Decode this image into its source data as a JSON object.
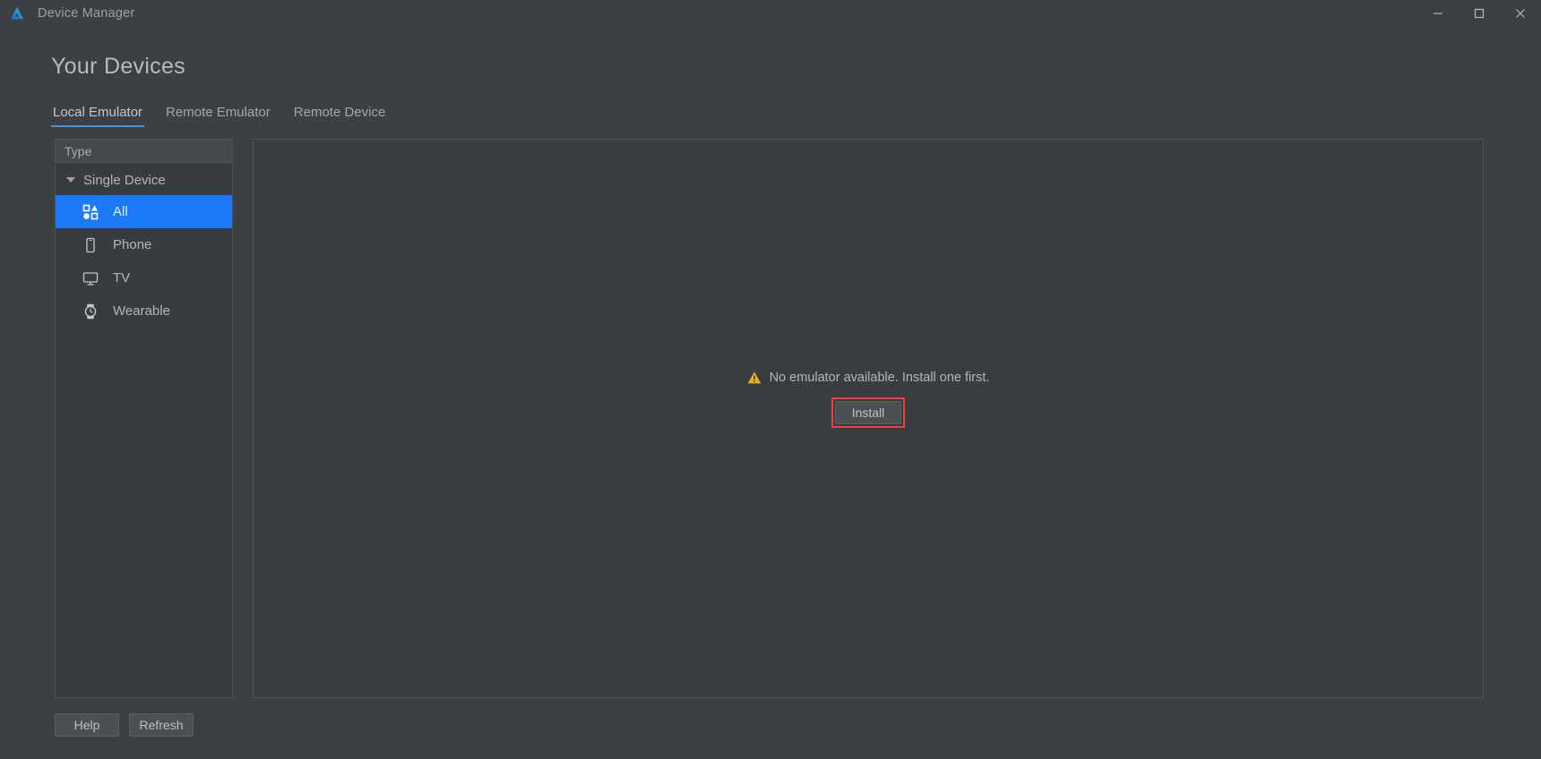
{
  "window": {
    "title": "Device Manager",
    "logo_icon": "device-manager-logo",
    "controls": [
      {
        "name": "minimize",
        "icon": "minimize-icon"
      },
      {
        "name": "maximize",
        "icon": "maximize-icon"
      },
      {
        "name": "close",
        "icon": "close-icon"
      }
    ]
  },
  "page": {
    "heading": "Your Devices"
  },
  "tabs": [
    {
      "label": "Local Emulator",
      "active": true
    },
    {
      "label": "Remote Emulator",
      "active": false
    },
    {
      "label": "Remote Device",
      "active": false
    }
  ],
  "sidebar": {
    "header": "Type",
    "group": {
      "label": "Single Device",
      "expanded": true,
      "caret_icon": "chevron-down-icon"
    },
    "items": [
      {
        "label": "All",
        "icon": "grid-shapes-icon",
        "selected": true
      },
      {
        "label": "Phone",
        "icon": "phone-icon",
        "selected": false
      },
      {
        "label": "TV",
        "icon": "tv-icon",
        "selected": false
      },
      {
        "label": "Wearable",
        "icon": "watch-icon",
        "selected": false
      }
    ]
  },
  "content": {
    "empty_state": {
      "warning_icon": "warning-triangle-icon",
      "message": "No emulator available. Install one first.",
      "install_label": "Install",
      "highlight_color": "#e8443a"
    }
  },
  "footer": {
    "help_label": "Help",
    "refresh_label": "Refresh"
  },
  "colors": {
    "background": "#3c4043",
    "panel": "#3a3d40",
    "selection": "#1a7af8",
    "tab_underline": "#4a90d9",
    "warning": "#f0ad20",
    "highlight": "#e8443a"
  }
}
